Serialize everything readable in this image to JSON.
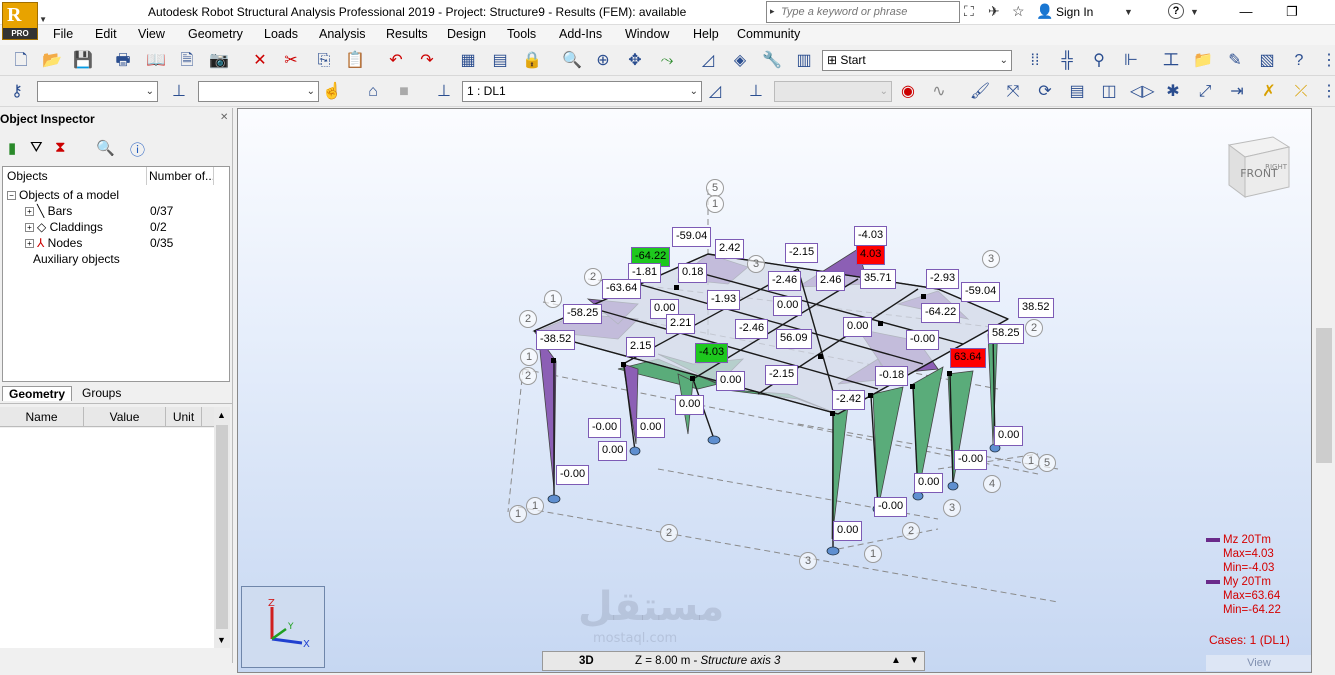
{
  "window": {
    "title": "Autodesk Robot Structural Analysis Professional 2019 - Project: Structure9 - Results (FEM): available",
    "logo_letter": "R",
    "logo_badge": "PRO",
    "search_placeholder": "Type a keyword or phrase",
    "sign_in": "Sign In",
    "help": "?",
    "minimize": "—",
    "restore": "❐"
  },
  "menu": [
    "File",
    "Edit",
    "View",
    "Geometry",
    "Loads",
    "Analysis",
    "Results",
    "Design",
    "Tools",
    "Add-Ins",
    "Window",
    "Help",
    "Community"
  ],
  "toolbar": {
    "layout_combo": "Start",
    "load_case_combo": "1 : DL1"
  },
  "inspector": {
    "title": "Object Inspector",
    "col_objects": "Objects",
    "col_number": "Number of...",
    "root": "Objects of a model",
    "items": [
      {
        "label": "Bars",
        "count": "0/37"
      },
      {
        "label": "Claddings",
        "count": "0/2"
      },
      {
        "label": "Nodes",
        "count": "0/35"
      }
    ],
    "auxiliary": "Auxiliary objects",
    "tabs": [
      "Geometry",
      "Groups"
    ],
    "prop_cols": [
      "Name",
      "Value",
      "Unit"
    ]
  },
  "viewport": {
    "cube_front": "FRONT",
    "cube_right": "RIGHT",
    "axis_labels": {
      "x": "X",
      "y": "Y",
      "z": "Z"
    },
    "legend": {
      "mz_title": "Mz  20Tm",
      "mz_max": "Max=4.03",
      "mz_min": "Min=-4.03",
      "my_title": "My  20Tm",
      "my_max": "Max=63.64",
      "my_min": "Min=-64.22"
    },
    "cases": "Cases: 1 (DL1)",
    "view_label": "View",
    "watermark": "مستقل",
    "watermark_sub": "mostaql.com",
    "labels": [
      {
        "id": "l1",
        "text": "-59.04",
        "style": "normal"
      },
      {
        "id": "l2",
        "text": "2.42",
        "style": "normal"
      },
      {
        "id": "l3",
        "text": "-64.22",
        "style": "green"
      },
      {
        "id": "l4",
        "text": "-1.81",
        "style": "normal"
      },
      {
        "id": "l5",
        "text": "0.18",
        "style": "normal"
      },
      {
        "id": "l6",
        "text": "-2.15",
        "style": "normal"
      },
      {
        "id": "l7",
        "text": "-4.03",
        "style": "normal"
      },
      {
        "id": "l8",
        "text": "4.03",
        "style": "red"
      },
      {
        "id": "l9",
        "text": "-63.64",
        "style": "normal"
      },
      {
        "id": "l10",
        "text": "-2.46",
        "style": "normal"
      },
      {
        "id": "l11",
        "text": "2.46",
        "style": "normal"
      },
      {
        "id": "l12",
        "text": "35.71",
        "style": "normal"
      },
      {
        "id": "l13",
        "text": "-2.93",
        "style": "normal"
      },
      {
        "id": "l14",
        "text": "-59.04",
        "style": "normal"
      },
      {
        "id": "l15",
        "text": "-58.25",
        "style": "normal"
      },
      {
        "id": "l16",
        "text": "0.00",
        "style": "normal"
      },
      {
        "id": "l17",
        "text": "-1.93",
        "style": "normal"
      },
      {
        "id": "l18",
        "text": "0.00",
        "style": "normal"
      },
      {
        "id": "l19",
        "text": "38.52",
        "style": "normal"
      },
      {
        "id": "l20",
        "text": "2.21",
        "style": "normal"
      },
      {
        "id": "l21",
        "text": "-2.46",
        "style": "normal"
      },
      {
        "id": "l22",
        "text": "-64.22",
        "style": "normal"
      },
      {
        "id": "l23",
        "text": "0.00",
        "style": "normal"
      },
      {
        "id": "l24",
        "text": "58.25",
        "style": "normal"
      },
      {
        "id": "l25",
        "text": "-38.52",
        "style": "normal"
      },
      {
        "id": "l26",
        "text": "2.15",
        "style": "normal"
      },
      {
        "id": "l27",
        "text": "-4.03",
        "style": "green"
      },
      {
        "id": "l28",
        "text": "56.09",
        "style": "normal"
      },
      {
        "id": "l29",
        "text": "-0.00",
        "style": "normal"
      },
      {
        "id": "l30",
        "text": "63.64",
        "style": "red"
      },
      {
        "id": "l31",
        "text": "0.00",
        "style": "normal"
      },
      {
        "id": "l32",
        "text": "-2.15",
        "style": "normal"
      },
      {
        "id": "l33",
        "text": "-0.18",
        "style": "normal"
      },
      {
        "id": "l34",
        "text": "0.00",
        "style": "normal"
      },
      {
        "id": "l35",
        "text": "-2.42",
        "style": "normal"
      },
      {
        "id": "l36",
        "text": "-0.00",
        "style": "normal"
      },
      {
        "id": "l37",
        "text": "0.00",
        "style": "normal"
      },
      {
        "id": "l38",
        "text": "0.00",
        "style": "normal"
      },
      {
        "id": "l39",
        "text": "0.00",
        "style": "normal"
      },
      {
        "id": "l40",
        "text": "-0.00",
        "style": "normal"
      },
      {
        "id": "l41",
        "text": "-0.00",
        "style": "normal"
      },
      {
        "id": "l42",
        "text": "0.00",
        "style": "normal"
      },
      {
        "id": "l43",
        "text": "-0.00",
        "style": "normal"
      },
      {
        "id": "l44",
        "text": "0.00",
        "style": "normal"
      }
    ],
    "grid_marks": [
      {
        "id": "g1",
        "text": "5"
      },
      {
        "id": "g2",
        "text": "1"
      },
      {
        "id": "g3",
        "text": "2"
      },
      {
        "id": "g4",
        "text": "1"
      },
      {
        "id": "g5",
        "text": "3"
      },
      {
        "id": "g6",
        "text": "2"
      },
      {
        "id": "g7",
        "text": "2"
      },
      {
        "id": "g8",
        "text": "1"
      },
      {
        "id": "g9",
        "text": "1"
      },
      {
        "id": "g10",
        "text": "5"
      },
      {
        "id": "g11",
        "text": "4"
      },
      {
        "id": "g12",
        "text": "3"
      },
      {
        "id": "g13",
        "text": "2"
      },
      {
        "id": "g14",
        "text": "1"
      },
      {
        "id": "g15",
        "text": "3"
      },
      {
        "id": "g16",
        "text": "2"
      },
      {
        "id": "g17",
        "text": "1"
      },
      {
        "id": "g18",
        "text": "1"
      },
      {
        "id": "g19",
        "text": "2"
      },
      {
        "id": "g20",
        "text": "3"
      }
    ]
  },
  "status": {
    "mode": "3D",
    "z_info": "Z = 8.00 m - ",
    "structure_axis": "Structure axis 3"
  }
}
